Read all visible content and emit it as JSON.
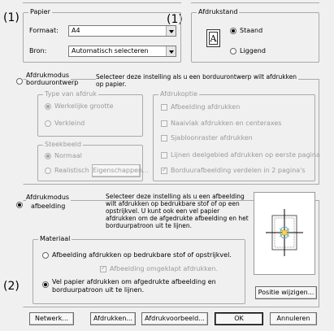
{
  "callouts": {
    "c1a": "(1)",
    "c1b": "(1)",
    "c2": "(2)"
  },
  "paper": {
    "legend": "Papier",
    "format_label": "Formaat:",
    "format_value": "A4",
    "source_label": "Bron:",
    "source_value": "Automatisch selecteren"
  },
  "orientation": {
    "legend": "Afdrukstand",
    "portrait": "Staand",
    "landscape": "Liggend",
    "selected": "portrait",
    "icon_letter": "A"
  },
  "embroidery_mode": {
    "label_line1": "Afdrukmodus",
    "label_line2": "borduurontwerp",
    "desc_line1": "Selecteer deze instelling als u een borduurontwerp wilt afdrukken",
    "desc_line2": "op papier.",
    "print_type": {
      "legend": "Type van afdruk",
      "actual_size": "Werkelijke grootte",
      "reduced": "Verkleind"
    },
    "print_options": {
      "legend": "Afdrukoptie",
      "opt1": "Afbeelding afdrukken",
      "opt2": "Naaivlak afdrukken en centeraxes",
      "opt3": "Sjabloonraster afdrukken",
      "opt4": "Lijnen deelgebied afdrukken op eerste pagina",
      "opt5": "Borduurafbeelding verdelen in 2 pagina's"
    },
    "stitch_image": {
      "legend": "Steekbeeld",
      "normal": "Normaal",
      "realistic": "Realistisch",
      "properties_button": "Eigenschappen..."
    }
  },
  "image_mode": {
    "label_line1": "Afdrukmodus",
    "label_line2": "afbeelding",
    "desc": [
      "Selecteer deze instelling als u een afbeelding",
      "wilt afdrukken op bedrukbare stof of op een",
      "opstrijkvel. U kunt ook een vel papier",
      "afdrukken om de afgedrukte afbeelding en het",
      "borduurpatroon uit te lijnen."
    ],
    "material": {
      "legend": "Materiaal",
      "opt1": "Afbeelding afdrukken op bedrukbare stof of opstrijkvel.",
      "mirror": "Afbeelding omgeklapt afdrukken.",
      "opt2_line1": "Vel papier afdrukken om afgedrukte afbeelding en",
      "opt2_line2": "borduurpatroon uit te lijnen."
    },
    "change_position_button": "Positie wijzigen..."
  },
  "buttons": {
    "network": "Netwerk...",
    "print": "Afdrukken...",
    "preview": "Afdrukvoorbeeld...",
    "ok": "OK",
    "cancel": "Annuleren"
  }
}
